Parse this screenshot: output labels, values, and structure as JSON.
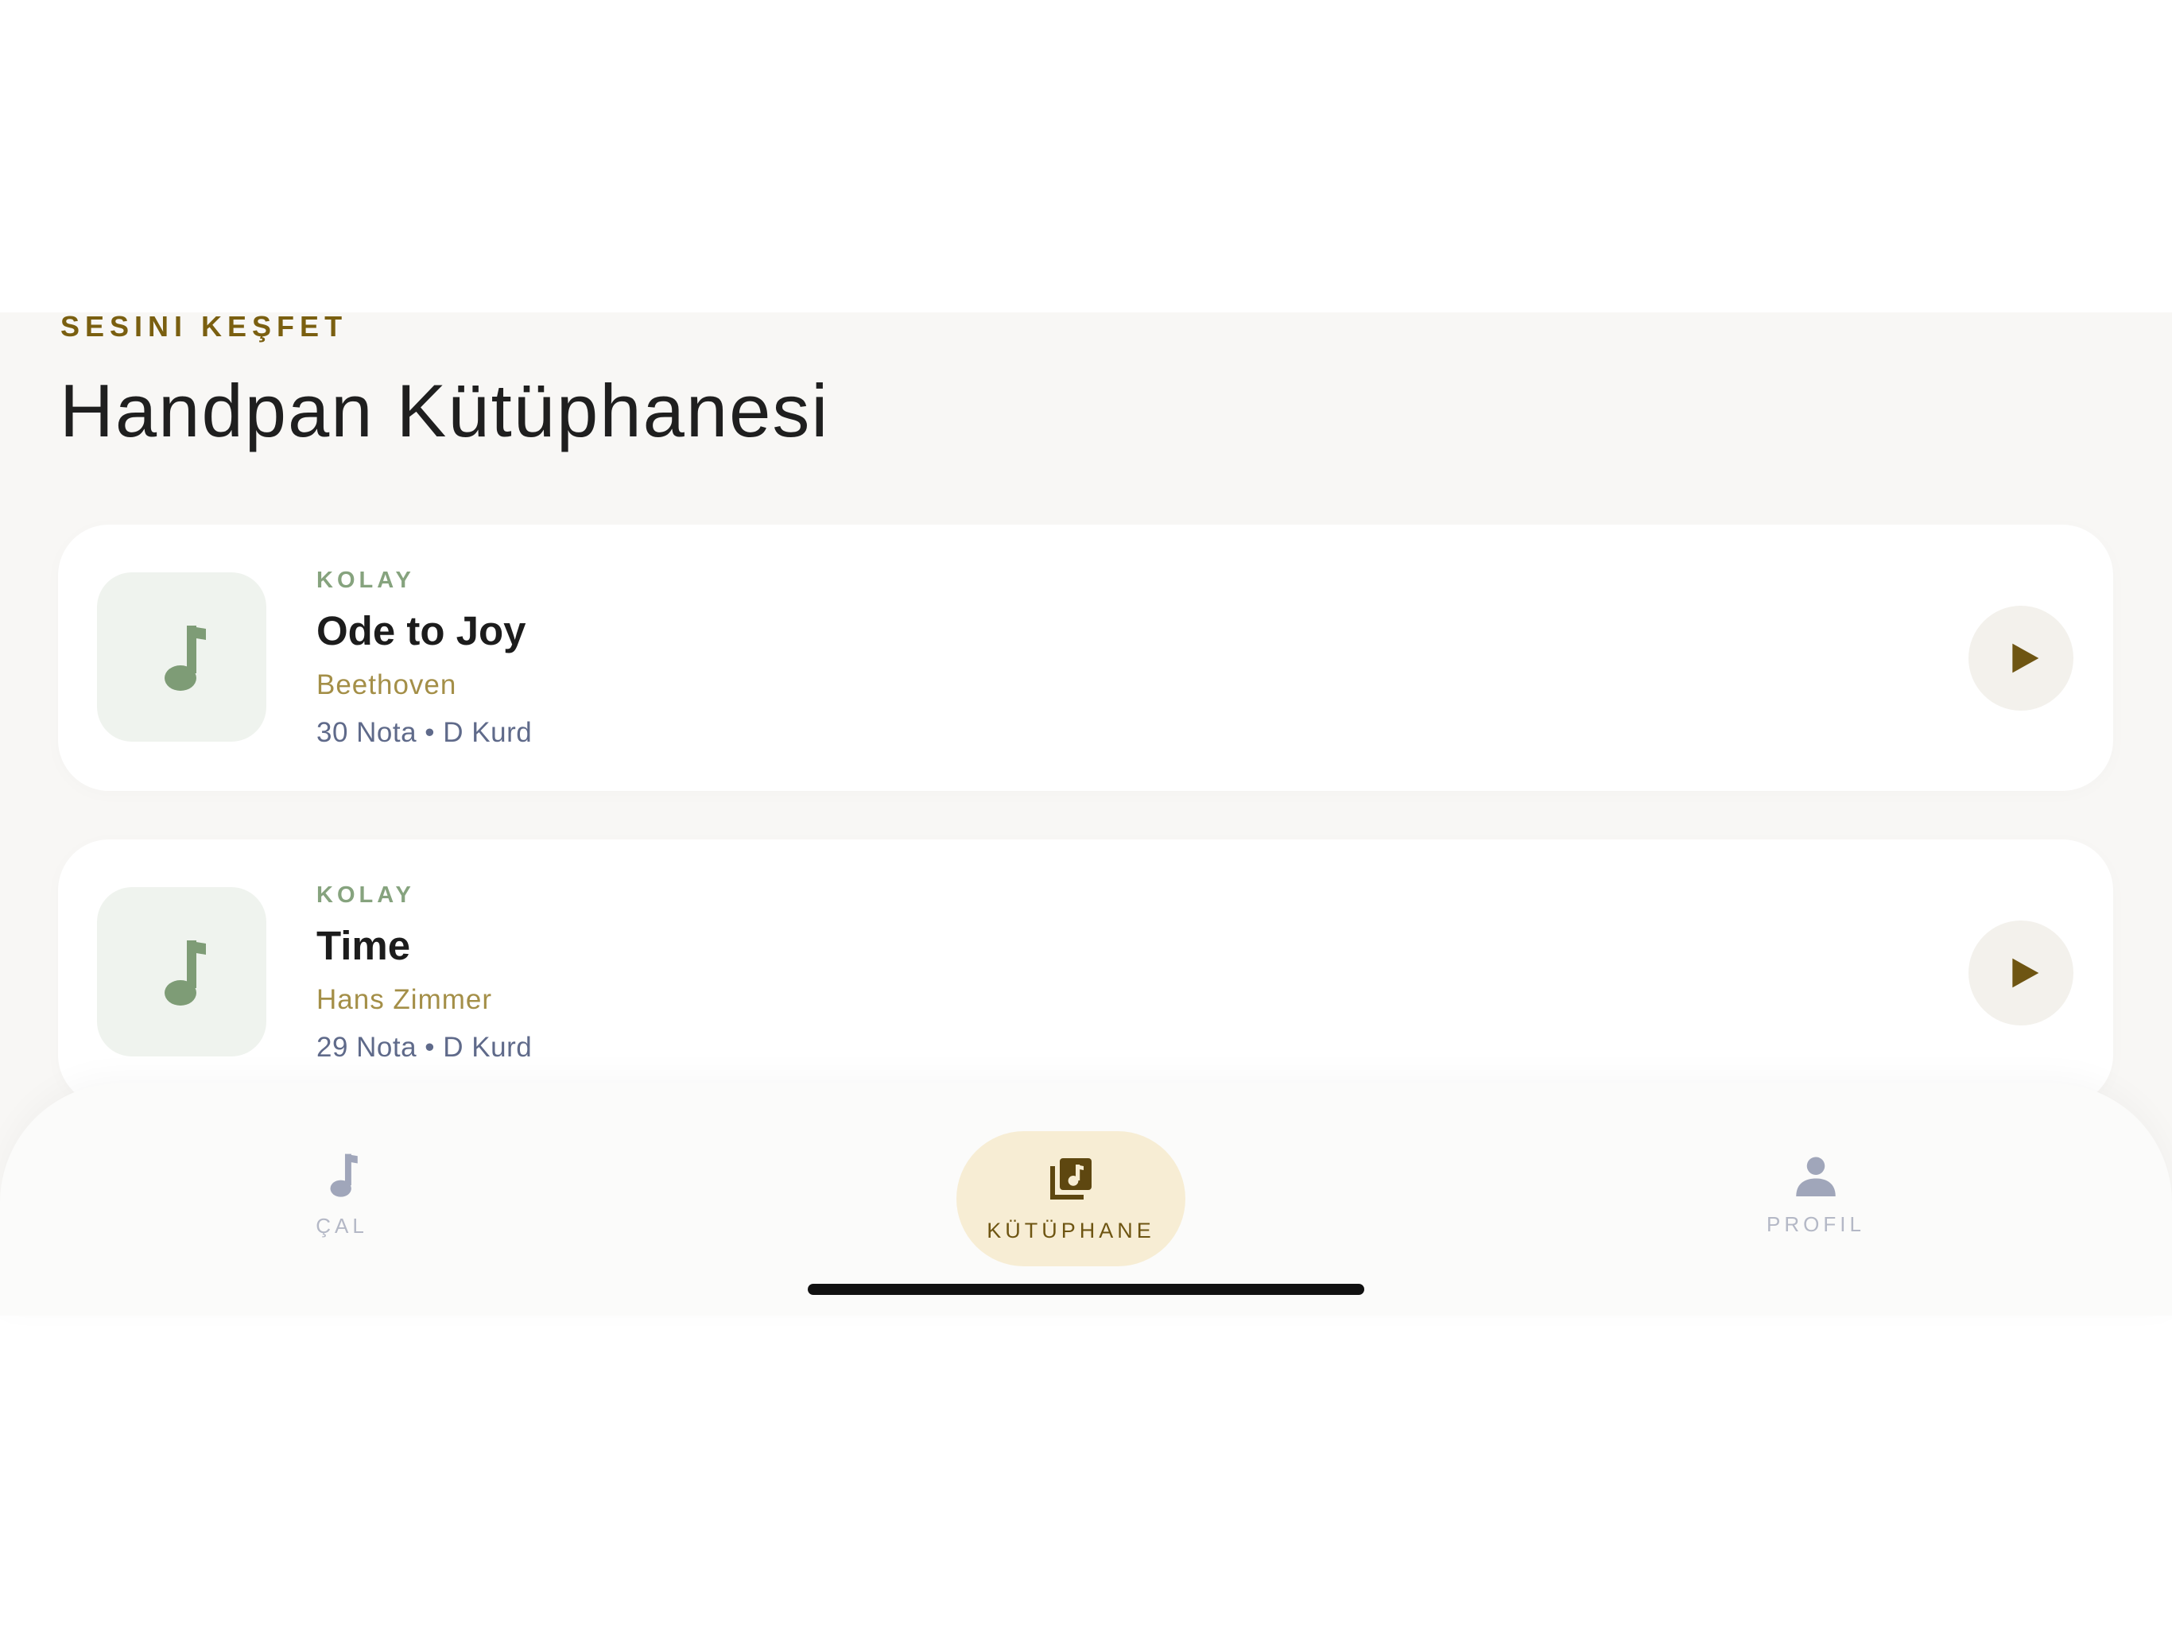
{
  "header": {
    "eyebrow": "SESINI KEŞFET",
    "title": "Handpan Kütüphanesi"
  },
  "songs": [
    {
      "level": "KOLAY",
      "title": "Ode to Joy",
      "composer": "Beethoven",
      "meta": "30 Nota • D Kurd"
    },
    {
      "level": "KOLAY",
      "title": "Time",
      "composer": "Hans Zimmer",
      "meta": "29 Nota • D Kurd"
    }
  ],
  "tabbar": {
    "tabs": [
      {
        "label": "ÇAL",
        "icon": "music-note-icon",
        "active": false
      },
      {
        "label": "KÜTÜPHANE",
        "icon": "library-music-icon",
        "active": true
      },
      {
        "label": "PROFIL",
        "icon": "person-icon",
        "active": false
      }
    ]
  },
  "colors": {
    "accent": "#7a5f10",
    "level_green": "#86a37e",
    "composer_gold": "#a48f48",
    "active_tab_bg": "#f7edd4"
  }
}
